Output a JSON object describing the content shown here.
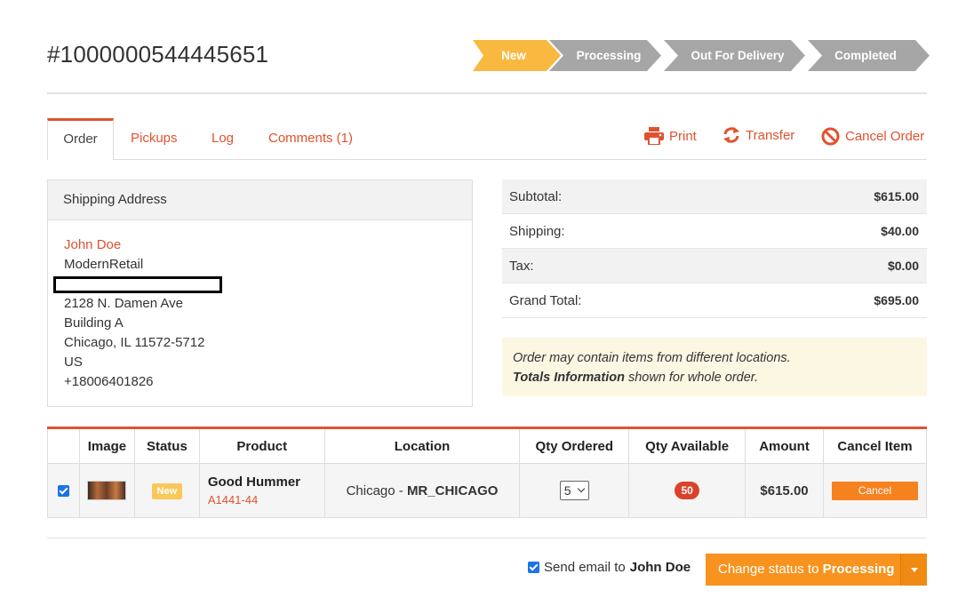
{
  "order": {
    "number": "#1000000544445651"
  },
  "status_steps": [
    {
      "label": "New",
      "color": "#f9b941",
      "active": true
    },
    {
      "label": "Processing",
      "color": "#a6a6a6",
      "active": false
    },
    {
      "label": "Out For Delivery",
      "color": "#a6a6a6",
      "active": false
    },
    {
      "label": "Completed",
      "color": "#a6a6a6",
      "active": false
    }
  ],
  "tabs": [
    {
      "label": "Order",
      "active": true
    },
    {
      "label": "Pickups",
      "active": false
    },
    {
      "label": "Log",
      "active": false
    },
    {
      "label": "Comments (1)",
      "active": false
    }
  ],
  "actions": {
    "print": {
      "label": "Print",
      "icon": "printer-icon"
    },
    "transfer": {
      "label": "Transfer",
      "icon": "transfer-icon"
    },
    "cancel": {
      "label": "Cancel Order",
      "icon": "ban-icon"
    }
  },
  "shipping": {
    "heading": "Shipping Address",
    "name": "John Doe",
    "company": "ModernRetail",
    "street": "2128 N. Damen Ave",
    "building": "Building A",
    "city_line": "Chicago, IL 11572-5712",
    "country": "US",
    "phone": "+18006401826"
  },
  "totals": [
    {
      "label": "Subtotal:",
      "value": "$615.00"
    },
    {
      "label": "Shipping:",
      "value": "$40.00"
    },
    {
      "label": "Tax:",
      "value": "$0.00"
    },
    {
      "label": "Grand Total:",
      "value": "$695.00"
    }
  ],
  "note": {
    "line1": "Order may contain items from different locations.",
    "line2_bold": "Totals Information",
    "line2_rest": " shown for whole order."
  },
  "items_table": {
    "headers": [
      "Image",
      "Status",
      "Product",
      "Location",
      "Qty Ordered",
      "Qty Available",
      "Amount",
      "Cancel Item"
    ],
    "rows": [
      {
        "checked": true,
        "status": "New",
        "product_name": "Good Hummer",
        "sku": "A1441-44",
        "location_city": "Chicago - ",
        "location_code": "MR_CHICAGO",
        "qty_ordered": "5",
        "qty_available": "50",
        "amount": "$615.00",
        "cancel_label": "Cancel"
      }
    ]
  },
  "footer": {
    "send_email_label": "Send email to ",
    "send_email_name": "John Doe",
    "send_email_checked": true,
    "change_status_prefix": "Change status to ",
    "change_status_target": "Processing"
  },
  "colors": {
    "accent": "#e0522f",
    "step_active": "#f9b941",
    "step_inactive": "#a6a6a6",
    "button_orange": "#f7931e"
  }
}
